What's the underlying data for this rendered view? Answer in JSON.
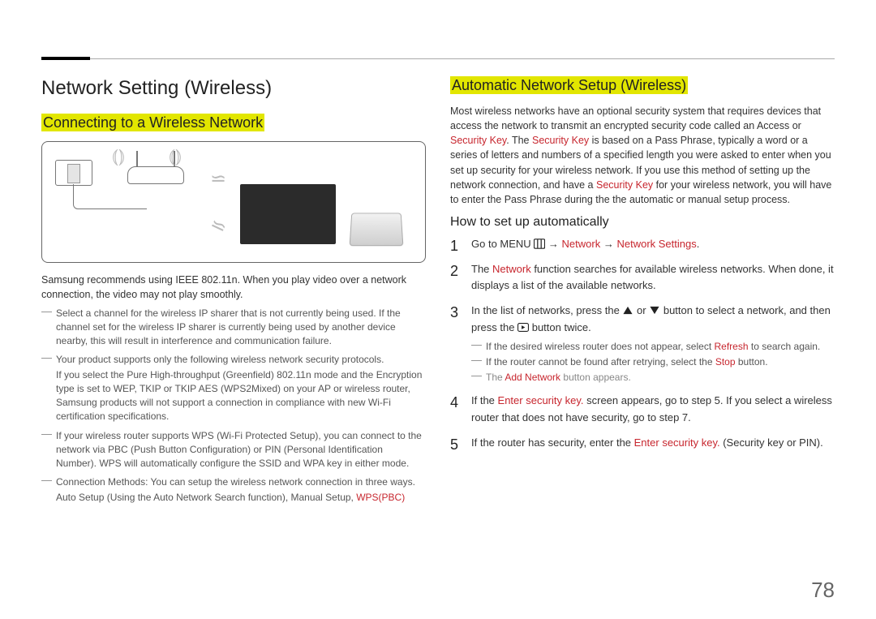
{
  "page_number": "78",
  "left": {
    "title": "Network Setting (Wireless)",
    "subtitle": "Connecting to a Wireless Network",
    "intro": "Samsung recommends using IEEE 802.11n. When you play video over a network connection, the video may not play smoothly.",
    "notes": [
      {
        "text": "Select a channel for the wireless IP sharer that is not currently being used. If the channel set for the wireless IP sharer is currently being used by another device nearby, this will result in interference and communication failure."
      },
      {
        "text": "Your product supports only the following wireless network security protocols.",
        "sub": "If you select the Pure High-throughput (Greenfield) 802.11n mode and the Encryption type is set to WEP, TKIP or TKIP AES (WPS2Mixed) on your AP or wireless router, Samsung products will not support a connection in compliance with new Wi-Fi certification specifications."
      },
      {
        "text": "If your wireless router supports WPS (Wi-Fi Protected Setup), you can connect to the network via PBC (Push Button Configuration) or PIN (Personal Identification Number). WPS will automatically configure the SSID and WPA key in either mode."
      },
      {
        "text": "Connection Methods: You can setup the wireless network connection in three ways.",
        "sub_prefix": "Auto Setup (Using the Auto Network Search function), Manual Setup, ",
        "sub_red": "WPS(PBC)"
      }
    ]
  },
  "right": {
    "title": "Automatic Network Setup (Wireless)",
    "intro_parts": {
      "p1": "Most wireless networks have an optional security system that requires devices that access the network to transmit an encrypted security code called an Access or ",
      "sk1": "Security Key",
      "p2": ". The ",
      "sk2": "Security Key",
      "p3": " is based on a Pass Phrase, typically a word or a series of letters and numbers of a specified length you were asked to enter when you set up security for your wireless network. If you use this method of setting up the network connection, and have a ",
      "sk3": "Security Key",
      "p4": " for your wireless network, you will have to enter the Pass Phrase during the the automatic or manual setup process."
    },
    "howto_heading": "How to set up automatically",
    "steps": {
      "s1": {
        "prefix": "Go to MENU ",
        "arrow": " → ",
        "net": "Network",
        "ns": "Network Settings",
        "suffix": "."
      },
      "s2": {
        "prefix": "The ",
        "net": "Network",
        "rest": " function searches for available wireless networks. When done, it displays a list of the available networks."
      },
      "s3": {
        "text_a": "In the list of networks, press the ",
        "text_b": " or ",
        "text_c": " button to select a network, and then press the ",
        "text_d": " button twice.",
        "subs": {
          "a_prefix": "If the desired wireless router does not appear, select ",
          "a_red": "Refresh",
          "a_suffix": " to search again.",
          "b_prefix": "If the router cannot be found after retrying, select the ",
          "b_red": "Stop",
          "b_suffix": " button.",
          "c_prefix": "The ",
          "c_red": "Add Network",
          "c_suffix": " button appears."
        }
      },
      "s4": {
        "prefix": "If the ",
        "red": "Enter security key.",
        "rest": " screen appears, go to step 5. If you select a wireless router that does not have security, go to step 7."
      },
      "s5": {
        "prefix": "If the router has security, enter the ",
        "red": "Enter security key.",
        "rest": " (Security key or PIN)."
      }
    }
  }
}
